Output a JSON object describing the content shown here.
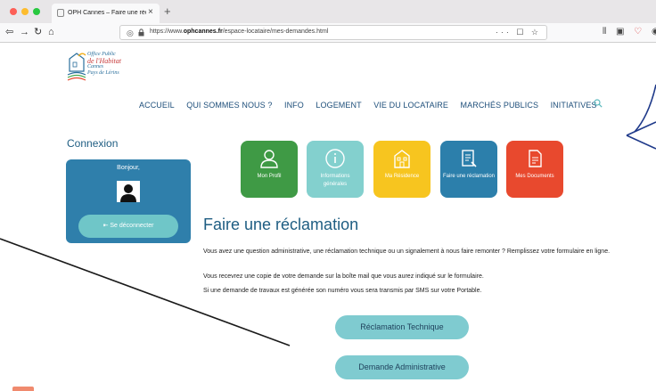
{
  "browser": {
    "tab_title": "OPH Cannes – Faire une réclam",
    "tab_close": "×",
    "new_tab": "+",
    "url_prefix": "https://www.",
    "url_domain": "ophcannes.fr",
    "url_path": "/espace-locataire/mes-demandes.html",
    "url_tools": "··· ☐ ☆"
  },
  "logo": {
    "line1": "Office Public",
    "line2": "de l'Habitat",
    "line3": "Cannes",
    "line4": "Pays de Lérins"
  },
  "mainnav": {
    "items": [
      "ACCUEIL",
      "QUI SOMMES NOUS ?",
      "INFO",
      "LOGEMENT",
      "VIE DU LOCATAIRE",
      "MARCHÉS PUBLICS",
      "INITIATIVES"
    ]
  },
  "login": {
    "heading": "Connexion",
    "greeting": "Bonjour,",
    "logout_label": "Se déconnecter"
  },
  "tiles": [
    {
      "label": "Mon Profil",
      "color": "#3f9a45"
    },
    {
      "label": "Informations générales",
      "color": "#83d0ce"
    },
    {
      "label": "Ma Résidence",
      "color": "#f7c51f"
    },
    {
      "label": "Faire une réclamation",
      "color": "#2c7fab"
    },
    {
      "label": "Mes Documents",
      "color": "#e8492e"
    }
  ],
  "main": {
    "title": "Faire une réclamation",
    "p1": "Vous avez une question administrative, une réclamation technique ou un signalement à nous faire remonter ? Remplissez votre formulaire en ligne.",
    "p2": "Vous recevrez une copie de votre demande sur la boîte mail que vous aurez indiqué  sur le formulaire.",
    "p3": "Si une demande de travaux est générée son numéro vous sera transmis par SMS sur votre Portable.",
    "btn_technique": "Réclamation Technique",
    "btn_administrative": "Demande Administrative"
  }
}
